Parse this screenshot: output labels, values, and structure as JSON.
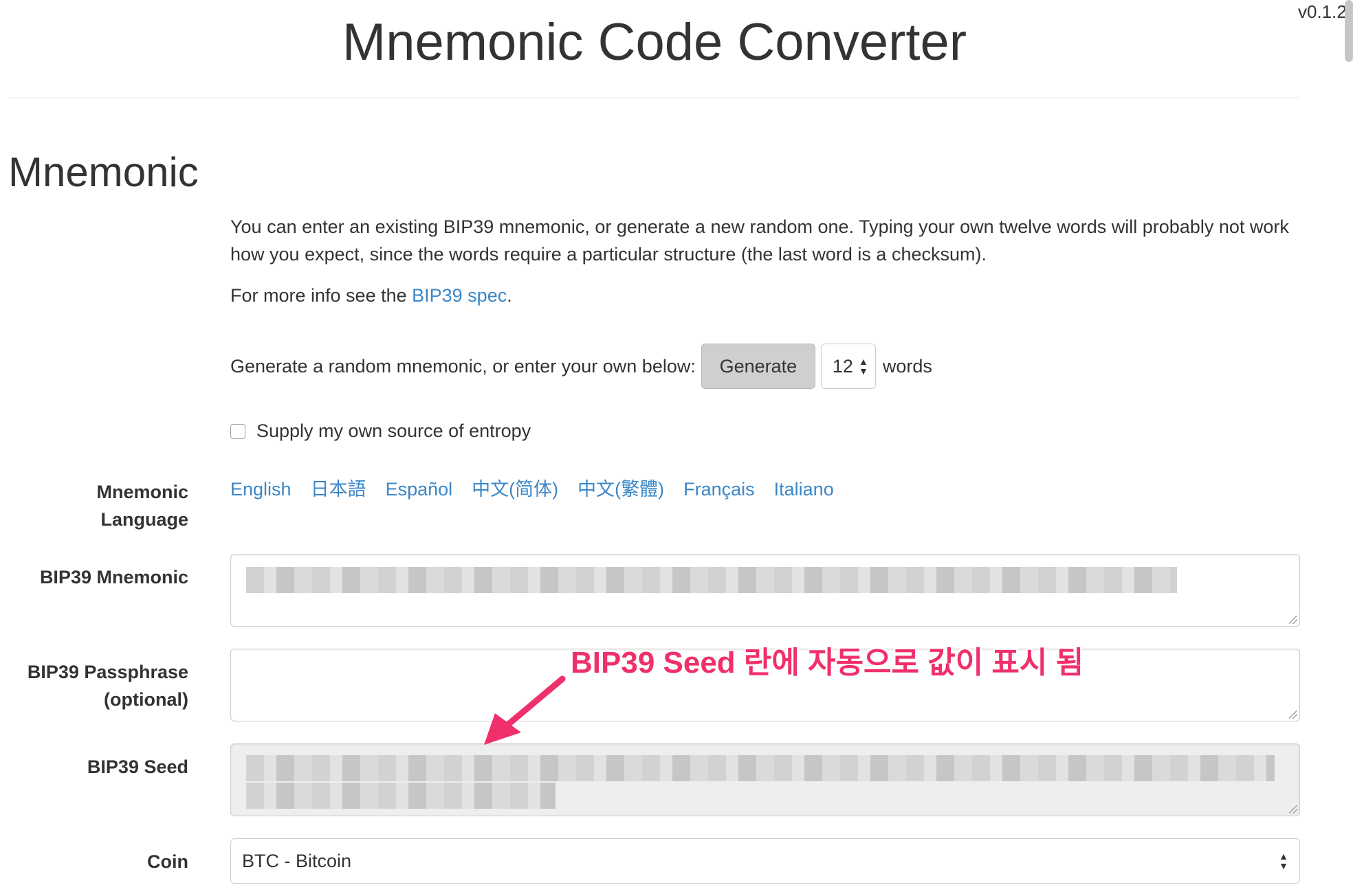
{
  "version": "v0.1.2",
  "title": "Mnemonic Code Converter",
  "section_title": "Mnemonic",
  "intro": "You can enter an existing BIP39 mnemonic, or generate a new random one. Typing your own twelve words will probably not work how you expect, since the words require a particular structure (the last word is a checksum).",
  "more_info": {
    "prefix": "For more info see the ",
    "link": "BIP39 spec",
    "suffix": "."
  },
  "generate": {
    "prompt": "Generate a random mnemonic, or enter your own below:",
    "button": "Generate",
    "word_count": "12",
    "suffix": "words"
  },
  "entropy_checkbox": {
    "label": "Supply my own source of entropy",
    "checked": false
  },
  "language": {
    "label_line1": "Mnemonic",
    "label_line2": "Language",
    "options": [
      "English",
      "日本語",
      "Español",
      "中文(简体)",
      "中文(繁體)",
      "Français",
      "Italiano"
    ]
  },
  "fields": {
    "mnemonic_label": "BIP39 Mnemonic",
    "passphrase_label_line1": "BIP39 Passphrase",
    "passphrase_label_line2": "(optional)",
    "seed_label": "BIP39 Seed",
    "coin_label": "Coin",
    "coin_value": "BTC - Bitcoin"
  },
  "annotation": "BIP39 Seed 란에 자동으로 값이 표시 됨",
  "colors": {
    "link": "#3a87c8",
    "annotation": "#f0306a",
    "button_bg": "#cfcfcf"
  }
}
